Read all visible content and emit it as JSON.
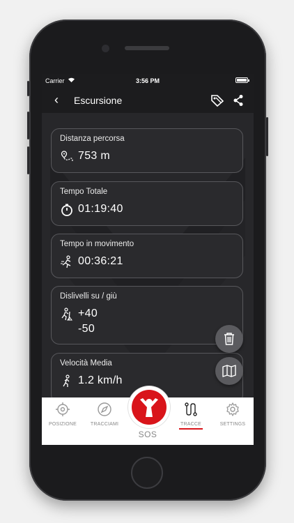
{
  "status": {
    "carrier": "Carrier",
    "time": "3:56 PM"
  },
  "nav": {
    "title": "Escursione"
  },
  "stats": [
    {
      "label": "Distanza percorsa",
      "value": "753 m",
      "icon": "distance-pin-icon"
    },
    {
      "label": "Tempo Totale",
      "value": "01:19:40",
      "icon": "stopwatch-icon"
    },
    {
      "label": "Tempo in movimento",
      "value": "00:36:21",
      "icon": "running-person-icon"
    },
    {
      "label": "Dislivelli su / giù",
      "value_up": "+40",
      "value_down": "-50",
      "icon": "hiker-climbing-icon"
    },
    {
      "label": "Velocità Media",
      "value": "1.2 km/h",
      "icon": "walking-person-icon"
    }
  ],
  "tabs": [
    {
      "label": "POSIZIONE",
      "icon": "crosshair-icon"
    },
    {
      "label": "TRACCIAMI",
      "icon": "compass-icon"
    },
    {
      "label": "SOS",
      "icon": "sos-person-icon"
    },
    {
      "label": "TRACCE",
      "icon": "track-path-icon",
      "active": true
    },
    {
      "label": "SETTINGS",
      "icon": "gear-icon"
    }
  ],
  "colors": {
    "accent": "#d9141a",
    "background": "#27272a",
    "card_border": "#58585c"
  }
}
